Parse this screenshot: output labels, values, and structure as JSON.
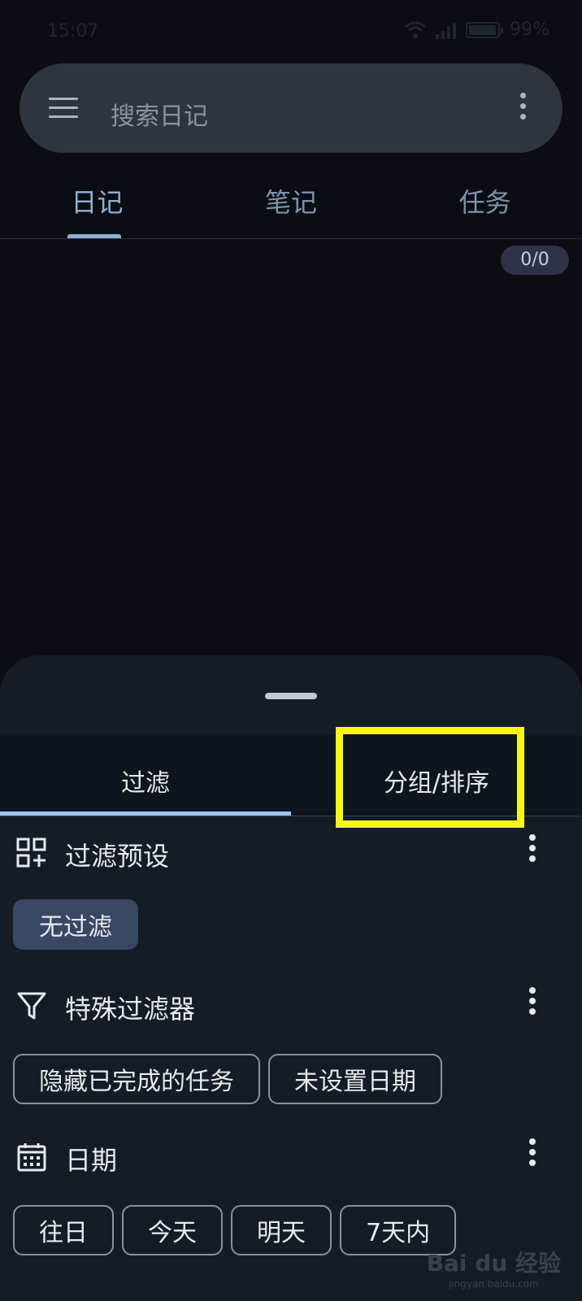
{
  "status_bar": {
    "time": "15:07",
    "battery": "99%",
    "battery_level": 0.99
  },
  "search": {
    "placeholder": "搜索日记"
  },
  "top_tabs": [
    {
      "label": "日记",
      "active": true
    },
    {
      "label": "笔记",
      "active": false
    },
    {
      "label": "任务",
      "active": false
    }
  ],
  "counter": "0/0",
  "sheet": {
    "tabs": [
      {
        "label": "过滤",
        "active": true
      },
      {
        "label": "分组/排序",
        "active": false,
        "highlighted": true
      }
    ],
    "sections": [
      {
        "title": "过滤预设",
        "icon": "grid-add-icon",
        "chips": [
          {
            "label": "无过滤",
            "selected": true
          }
        ]
      },
      {
        "title": "特殊过滤器",
        "icon": "filter-icon",
        "chips": [
          {
            "label": "隐藏已完成的任务"
          },
          {
            "label": "未设置日期"
          }
        ]
      },
      {
        "title": "日期",
        "icon": "calendar-icon",
        "chips": [
          {
            "label": "往日"
          },
          {
            "label": "今天"
          },
          {
            "label": "明天"
          },
          {
            "label": "7天内"
          }
        ]
      }
    ]
  },
  "watermark": {
    "main": "Bai du 经验",
    "sub": "jingyan.baidu.com"
  },
  "colors": {
    "highlight": "#f5f518",
    "accent": "#8fb0d6",
    "sheet_bg": "#151c25"
  }
}
